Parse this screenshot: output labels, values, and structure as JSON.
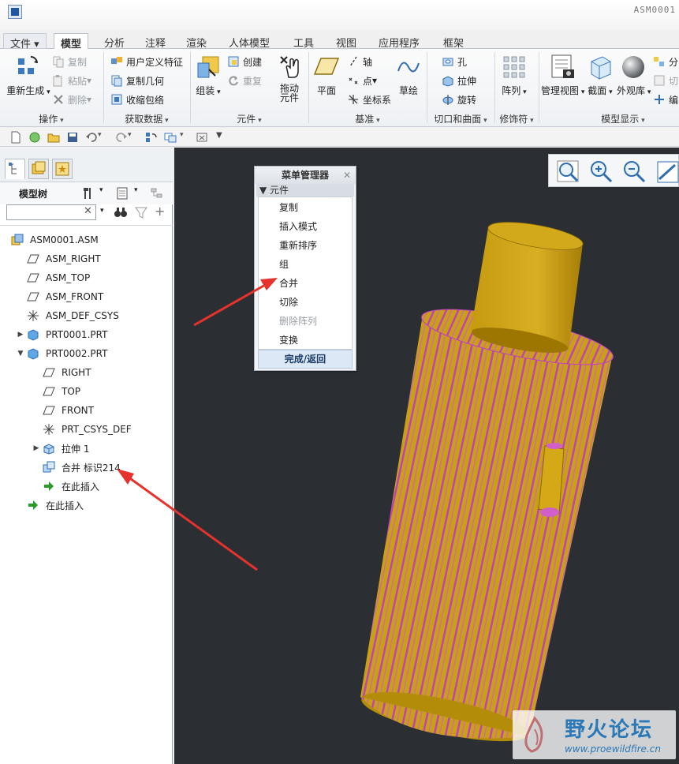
{
  "window": {
    "title": "ASM0001"
  },
  "ribbon": {
    "tabs": [
      "文件",
      "模型",
      "分析",
      "注释",
      "渲染",
      "人体模型",
      "工具",
      "视图",
      "应用程序",
      "框架"
    ],
    "groups": {
      "operations": {
        "footer": "操作",
        "regenerate": "重新生成",
        "copy": "复制",
        "paste": "粘贴",
        "delete": "删除"
      },
      "get_data": {
        "footer": "获取数据",
        "udf": "用户定义特征",
        "copy_geom": "复制几何",
        "shrinkwrap": "收缩包络"
      },
      "component": {
        "footer": "元件",
        "assemble": "组装",
        "create": "创建",
        "repeat": "重复",
        "drag": "拖动",
        "drag2": "元件"
      },
      "datum": {
        "footer": "基准",
        "plane": "平面",
        "axis": "轴",
        "point": "点",
        "csys": "坐标系",
        "sketch": "草绘"
      },
      "cut_surface": {
        "footer": "切口和曲面",
        "hole": "孔",
        "extrude": "拉伸",
        "revolve": "旋转"
      },
      "modifiers": {
        "footer": "修饰符",
        "pattern": "阵列"
      },
      "model_display": {
        "footer": "模型显示",
        "manage_views": "管理视图",
        "section": "截面",
        "appearance": "外观库",
        "explode": "分",
        "cut": "切",
        "edit": "编"
      }
    }
  },
  "model_tree": {
    "title": "模型树",
    "items": [
      {
        "label": "ASM0001.ASM"
      },
      {
        "label": "ASM_RIGHT"
      },
      {
        "label": "ASM_TOP"
      },
      {
        "label": "ASM_FRONT"
      },
      {
        "label": "ASM_DEF_CSYS"
      },
      {
        "label": "PRT0001.PRT"
      },
      {
        "label": "PRT0002.PRT"
      },
      {
        "label": "RIGHT"
      },
      {
        "label": "TOP"
      },
      {
        "label": "FRONT"
      },
      {
        "label": "PRT_CSYS_DEF"
      },
      {
        "label": "拉伸 1"
      },
      {
        "label": "合并 标识214"
      },
      {
        "label": "在此插入"
      },
      {
        "label": "在此插入"
      }
    ]
  },
  "menu_manager": {
    "title": "菜单管理器",
    "section": "元件",
    "items": [
      "复制",
      "插入模式",
      "重新排序",
      "组",
      "合并",
      "切除",
      "删除阵列",
      "变换"
    ],
    "done": "完成/返回"
  },
  "watermark": {
    "title": "野火论坛",
    "url": "www.proewildfire.cn"
  },
  "colors": {
    "accent": "#1f57a0",
    "body_yellow": "#c9a012",
    "stripe_magenta": "#c040c0",
    "annotation_red": "#e5322c",
    "viewport_bg": "#2b2f34"
  }
}
